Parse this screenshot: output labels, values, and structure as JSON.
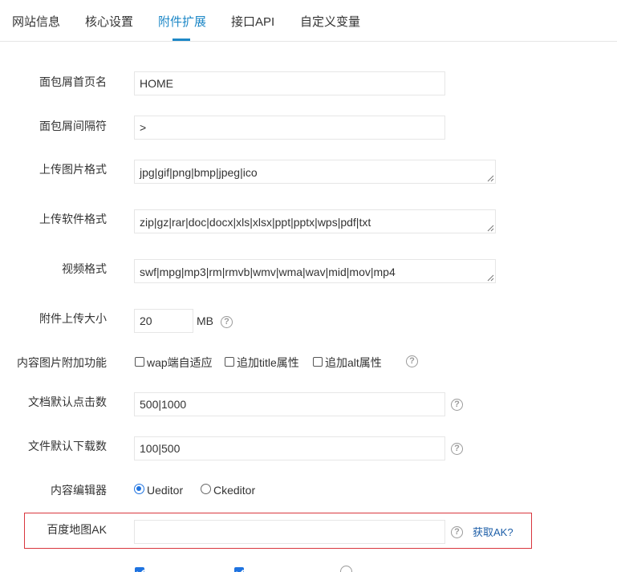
{
  "tabs": [
    {
      "label": "网站信息"
    },
    {
      "label": "核心设置"
    },
    {
      "label": "附件扩展"
    },
    {
      "label": "接口API"
    },
    {
      "label": "自定义变量"
    }
  ],
  "active_tab": "附件扩展",
  "accent_color": "#1e88c7",
  "form": {
    "breadcrumb_home": {
      "label": "面包屑首页名",
      "value": "HOME"
    },
    "breadcrumb_separator": {
      "label": "面包屑间隔符",
      "value": ">"
    },
    "upload_image_formats": {
      "label": "上传图片格式",
      "value": "jpg|gif|png|bmp|jpeg|ico"
    },
    "upload_software_formats": {
      "label": "上传软件格式",
      "value": "zip|gz|rar|doc|docx|xls|xlsx|ppt|pptx|wps|pdf|txt"
    },
    "video_formats": {
      "label": "视频格式",
      "value": "swf|mpg|mp3|rm|rmvb|wmv|wma|wav|mid|mov|mp4"
    },
    "attachment_size": {
      "label": "附件上传大小",
      "value": "20",
      "unit": "MB"
    },
    "content_image_features": {
      "label": "内容图片附加功能",
      "options": [
        {
          "label": "wap端自适应",
          "checked": false
        },
        {
          "label": "追加title属性",
          "checked": false
        },
        {
          "label": "追加alt属性",
          "checked": false
        }
      ]
    },
    "doc_default_clicks": {
      "label": "文档默认点击数",
      "value": "500|1000"
    },
    "file_default_downloads": {
      "label": "文件默认下载数",
      "value": "100|500"
    },
    "content_editor": {
      "label": "内容编辑器",
      "options": [
        {
          "label": "Ueditor",
          "selected": true
        },
        {
          "label": "Ckeditor",
          "selected": false
        }
      ]
    },
    "baidu_map_ak": {
      "label": "百度地图AK",
      "value": "",
      "link": "获取AK?"
    }
  },
  "icons": {
    "help": "question-circle-icon"
  },
  "help_glyph": "?"
}
